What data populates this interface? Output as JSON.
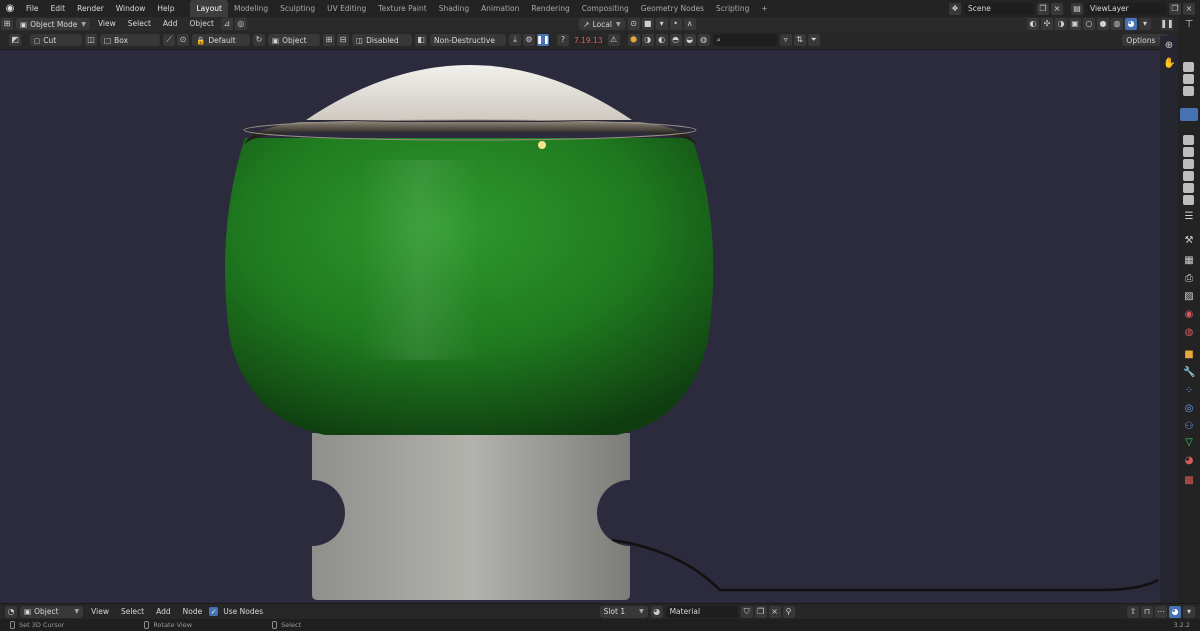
{
  "top_menu": {
    "items": [
      "File",
      "Edit",
      "Render",
      "Window",
      "Help"
    ]
  },
  "workspaces": {
    "tabs": [
      "Layout",
      "Modeling",
      "Sculpting",
      "UV Editing",
      "Texture Paint",
      "Shading",
      "Animation",
      "Rendering",
      "Compositing",
      "Geometry Nodes",
      "Scripting"
    ],
    "active": "Layout",
    "add_label": "+"
  },
  "scene": {
    "name": "Scene"
  },
  "view_layer": {
    "name": "ViewLayer"
  },
  "header": {
    "mode": "Object Mode",
    "menus": [
      "View",
      "Select",
      "Add",
      "Object"
    ],
    "orientation": "Local"
  },
  "tool_settings": {
    "cut_label": "Cut",
    "box_label": "Box",
    "default_label": "Default",
    "object_label": "Object",
    "disabled_label": "Disabled",
    "nondestructive_label": "Non-Destructive",
    "version_value": "7.19.13",
    "options_label": "Options"
  },
  "bottom_header": {
    "object_label": "Object",
    "menus": [
      "View",
      "Select",
      "Add",
      "Node"
    ],
    "use_nodes_label": "Use Nodes",
    "slot_label": "Slot 1",
    "material_label": "Material"
  },
  "status_bar": {
    "set_cursor": "Set 3D Cursor",
    "rotate_view": "Rotate View",
    "select": "Select",
    "version": "3.2.2"
  },
  "colors": {
    "accent": "#4772b3",
    "viewport_bg": "#2b2b3d",
    "lamp_green": "#1f7a1f",
    "lamp_base": "#a9a9a5"
  }
}
